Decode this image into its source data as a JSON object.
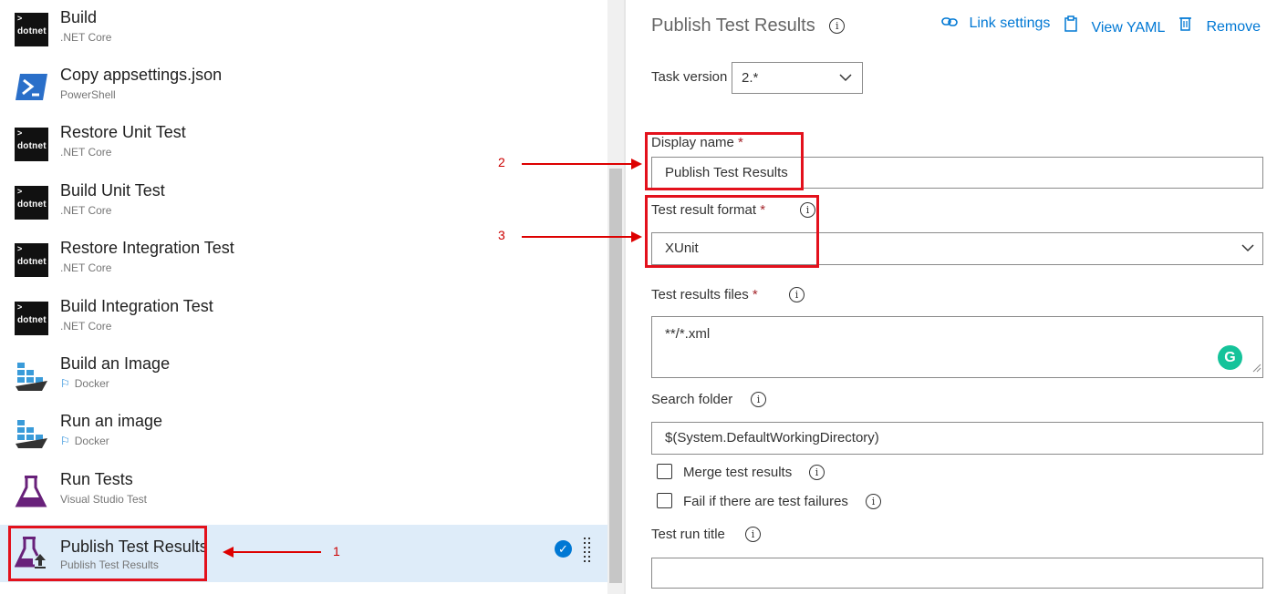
{
  "tasks": [
    {
      "name": "Build",
      "sub": ".NET Core",
      "icon": "dotnet-icon"
    },
    {
      "name": "Copy appsettings.json",
      "sub": "PowerShell",
      "icon": "powershell-icon"
    },
    {
      "name": "Restore Unit Test",
      "sub": ".NET Core",
      "icon": "dotnet-icon"
    },
    {
      "name": "Build Unit Test",
      "sub": ".NET Core",
      "icon": "dotnet-icon"
    },
    {
      "name": "Restore Integration Test",
      "sub": ".NET Core",
      "icon": "dotnet-icon"
    },
    {
      "name": "Build Integration Test",
      "sub": ".NET Core",
      "icon": "dotnet-icon"
    },
    {
      "name": "Build an Image",
      "sub": "Docker",
      "icon": "docker-icon"
    },
    {
      "name": "Run an image",
      "sub": "Docker",
      "icon": "docker-icon"
    },
    {
      "name": "Run Tests",
      "sub": "Visual Studio Test",
      "icon": "flask-icon"
    },
    {
      "name": "Publish Test Results",
      "sub": "Publish Test Results",
      "icon": "flask-upload-icon",
      "selected": true
    }
  ],
  "dotnet_logo": "dotnet",
  "annotations": {
    "one": "1",
    "two": "2",
    "three": "3"
  },
  "panel": {
    "title": "Publish Test Results",
    "link_settings": "Link settings",
    "view_yaml": "View YAML",
    "remove": "Remove",
    "task_version_label": "Task version",
    "task_version_value": "2.*",
    "display_name_label": "Display name",
    "display_name_value": "Publish Test Results",
    "format_label": "Test result format",
    "format_value": "XUnit",
    "files_label": "Test results files",
    "files_value": "**/*.xml",
    "search_label": "Search folder",
    "search_value": "$(System.DefaultWorkingDirectory)",
    "merge_label": "Merge test results",
    "fail_label": "Fail if there are test failures",
    "run_title_label": "Test run title",
    "run_title_value": "",
    "required_mark": "*"
  },
  "colors": {
    "accent": "#0078d4",
    "selected_bg": "#deecf9",
    "annotation_red": "#e3111c",
    "required": "#a4262c"
  }
}
